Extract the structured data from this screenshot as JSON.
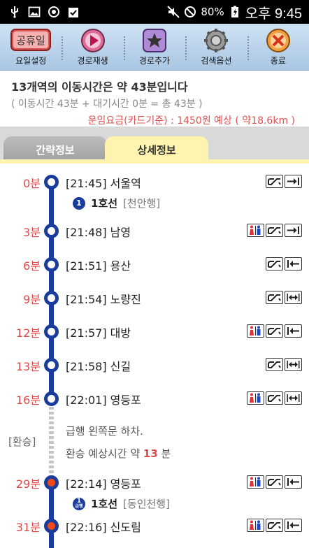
{
  "status_bar": {
    "battery": "80%",
    "time": "오후 9:45"
  },
  "toolbar": {
    "holiday_badge": "공휴일",
    "items": [
      {
        "label": "요일설정",
        "icon": "holiday-calendar-icon"
      },
      {
        "label": "경로재생",
        "icon": "play-icon"
      },
      {
        "label": "경로추가",
        "icon": "star-icon"
      },
      {
        "label": "검색옵션",
        "icon": "gear-icon"
      },
      {
        "label": "종료",
        "icon": "close-icon"
      }
    ]
  },
  "summary": {
    "count_prefix": "13",
    "count_suffix": "개역의 이동시간은 약 43분입니다",
    "detail": "( 이동시간 43분 + 대기시간 0분 = 총 43분 )",
    "fare": "운임요금(카드기준) : 1450원 예상 ( 약18.6km )"
  },
  "tabs": {
    "brief": "간략정보",
    "detail": "상세정보"
  },
  "route": {
    "stations": [
      {
        "min": "0분",
        "text": "[21:45] 서울역",
        "icons": [
          "escalator-icon",
          "exit-right-icon"
        ],
        "line_badge": "1",
        "line_name": "1호선",
        "line_dir": "[천안행]"
      },
      {
        "min": "3분",
        "text": "[21:48] 남영",
        "icons": [
          "restroom-icon",
          "escalator-icon",
          "exit-right-icon"
        ]
      },
      {
        "min": "6분",
        "text": "[21:51] 용산",
        "icons": [
          "escalator-icon",
          "exit-left-icon"
        ]
      },
      {
        "min": "9분",
        "text": "[21:54] 노량진",
        "icons": [
          "escalator-icon",
          "exit-both-icon"
        ]
      },
      {
        "min": "12분",
        "text": "[21:57] 대방",
        "icons": [
          "restroom-icon",
          "escalator-icon",
          "exit-left-icon"
        ]
      },
      {
        "min": "13분",
        "text": "[21:58] 신길",
        "icons": [
          "escalator-icon",
          "exit-both-icon"
        ]
      },
      {
        "min": "16분",
        "text": "[22:01] 영등포",
        "icons": [
          "restroom-icon",
          "escalator-icon",
          "exit-both-icon"
        ]
      },
      {
        "min": "29분",
        "text": "[22:14] 영등포",
        "icons": [
          "restroom-icon",
          "escalator-icon",
          "exit-left-icon"
        ],
        "line_badge": "1",
        "line_badge_sub": "급행",
        "line_name": "1호선",
        "line_dir": "[동인천행]"
      },
      {
        "min": "31분",
        "text": "[22:16] 신도림",
        "icons": [
          "restroom-icon",
          "escalator-icon",
          "exit-left-icon"
        ]
      }
    ],
    "transfer": {
      "label": "[환승]",
      "line1": "급행 왼쪽문 하차.",
      "line2_prefix": "환승 예상시간 약 ",
      "line2_value": "13",
      "line2_suffix": " 분"
    }
  }
}
